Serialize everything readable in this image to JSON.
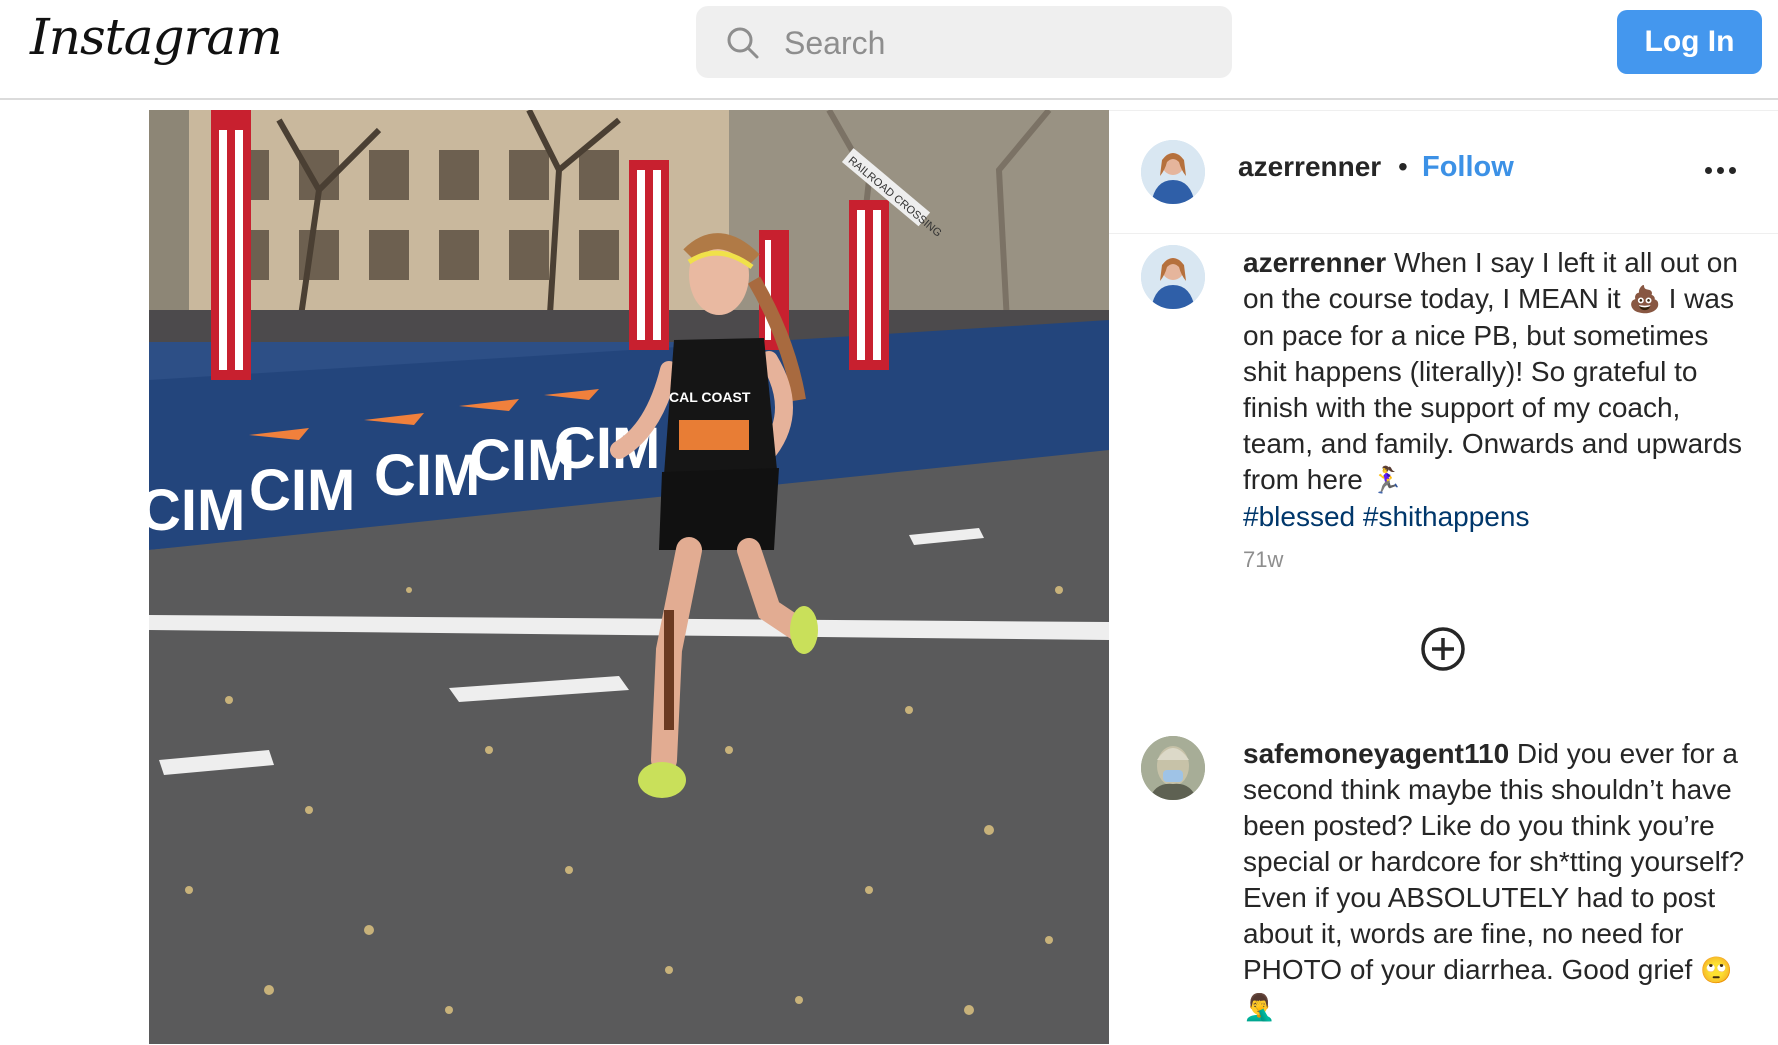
{
  "header": {
    "logo": "Instagram",
    "search_placeholder": "Search",
    "login_label": "Log In"
  },
  "post": {
    "username": "azerrenner",
    "separator": "•",
    "follow_label": "Follow",
    "caption": {
      "username": "azerrenner",
      "text_1": "When I say I left it all out on on the course today, I MEAN it",
      "emoji_1": "💩",
      "text_2": "I was on pace for a nice PB, but sometimes shit happens (literally)! So grateful to finish with the support of my coach, team, and family. Onwards and upwards from here",
      "emoji_2": "🏃‍♀️",
      "hashtags": [
        "#blessed",
        "#shithappens"
      ]
    },
    "timestamp": "71w"
  },
  "comments": [
    {
      "username": "safemoneyagent110",
      "text": "Did you ever for a second think maybe this shouldn’t have been posted? Like do you think you’re special or hardcore for sh*tting yourself? Even if you ABSOLUTELY had to post about it, words are fine, no need for PHOTO of your diarrhea. Good grief",
      "emojis": "🙄🤦‍♂️"
    }
  ],
  "photo": {
    "sign_text": "CIM",
    "shirt_text": "CAL COAST",
    "crossing_sign": "RAILROAD CROSSING"
  },
  "colors": {
    "accent": "#4497ee",
    "follow": "#3c91e6",
    "hashtag": "#00376b",
    "muted": "#8e8e8e",
    "barrier": "#23457c"
  },
  "icons": {
    "search": "search-icon",
    "more": "more-options-icon",
    "load_more": "plus-circle-icon"
  }
}
